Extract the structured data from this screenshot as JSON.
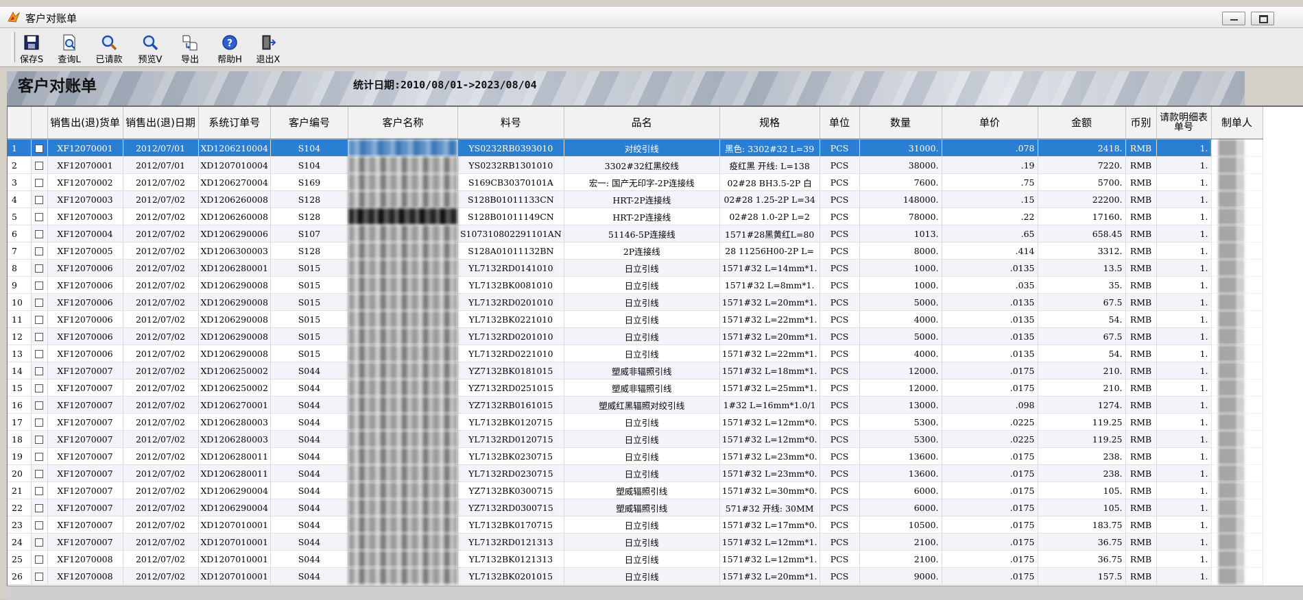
{
  "window": {
    "title": "客户对账单"
  },
  "toolbar": {
    "buttons": [
      {
        "id": "save",
        "label": "保存S",
        "icon": "save-icon"
      },
      {
        "id": "query",
        "label": "查询L",
        "icon": "document-search-icon"
      },
      {
        "id": "requested",
        "label": "已请款",
        "icon": "magnifier-icon"
      },
      {
        "id": "preview",
        "label": "预览V",
        "icon": "magnifier-icon"
      },
      {
        "id": "export",
        "label": "导出",
        "icon": "export-icon"
      },
      {
        "id": "help",
        "label": "帮助H",
        "icon": "help-icon"
      },
      {
        "id": "exit",
        "label": "退出X",
        "icon": "exit-door-icon"
      }
    ]
  },
  "report": {
    "title": "客户对账单",
    "date_range": "统计日期:2010/08/01->2023/08/04"
  },
  "grid": {
    "columns": [
      "",
      "",
      "销售出(退)货单",
      "销售出(退)日期",
      "系统订单号",
      "客户编号",
      "客户名称",
      "料号",
      "品名",
      "规格",
      "单位",
      "数量",
      "单价",
      "金额",
      "币别",
      "请款明细表单号",
      "制单人"
    ],
    "rows": [
      [
        "1",
        "XF12070001",
        "2012/07/01",
        "XD1206210004",
        "S104",
        "YS0232RB0393010",
        "对绞引线",
        "黑色: 3302#32 L=39",
        "PCS",
        "31000.",
        ".078",
        "2418.",
        "RMB",
        "1."
      ],
      [
        "2",
        "XF12070001",
        "2012/07/01",
        "XD1207010004",
        "S104",
        "YS0232RB1301010",
        "3302#32红黑绞线",
        "疫红黑 开线: L=138",
        "PCS",
        "38000.",
        ".19",
        "7220.",
        "RMB",
        "1."
      ],
      [
        "3",
        "XF12070002",
        "2012/07/02",
        "XD1206270004",
        "S169",
        "S169CB30370101A",
        "宏一: 国产无印字-2P连接线",
        "02#28 BH3.5-2P 白",
        "PCS",
        "7600.",
        ".75",
        "5700.",
        "RMB",
        "1."
      ],
      [
        "4",
        "XF12070003",
        "2012/07/02",
        "XD1206260008",
        "S128",
        "S128B01011133CN",
        "HRT-2P连接线",
        "02#28 1.25-2P L=34",
        "PCS",
        "148000.",
        ".15",
        "22200.",
        "RMB",
        "1."
      ],
      [
        "5",
        "XF12070003",
        "2012/07/02",
        "XD1206260008",
        "S128",
        "S128B01011149CN",
        "HRT-2P连接线",
        "02#28 1.0-2P L=2",
        "PCS",
        "78000.",
        ".22",
        "17160.",
        "RMB",
        "1."
      ],
      [
        "6",
        "XF12070004",
        "2012/07/02",
        "XD1206290006",
        "S107",
        "S107310802291101AN",
        "51146-5P连接线",
        "1571#28黑黄红L=80",
        "PCS",
        "1013.",
        ".65",
        "658.45",
        "RMB",
        "1."
      ],
      [
        "7",
        "XF12070005",
        "2012/07/02",
        "XD1206300003",
        "S128",
        "S128A01011132BN",
        "2P连接线",
        "28 11256H00-2P L=",
        "PCS",
        "8000.",
        ".414",
        "3312.",
        "RMB",
        "1."
      ],
      [
        "8",
        "XF12070006",
        "2012/07/02",
        "XD1206280001",
        "S015",
        "YL7132RD0141010",
        "日立引线",
        "1571#32 L=14mm*1.",
        "PCS",
        "1000.",
        ".0135",
        "13.5",
        "RMB",
        "1."
      ],
      [
        "9",
        "XF12070006",
        "2012/07/02",
        "XD1206290008",
        "S015",
        "YL7132BK0081010",
        "日立引线",
        "1571#32 L=8mm*1.",
        "PCS",
        "1000.",
        ".035",
        "35.",
        "RMB",
        "1."
      ],
      [
        "10",
        "XF12070006",
        "2012/07/02",
        "XD1206290008",
        "S015",
        "YL7132RD0201010",
        "日立引线",
        "1571#32 L=20mm*1.",
        "PCS",
        "5000.",
        ".0135",
        "67.5",
        "RMB",
        "1."
      ],
      [
        "11",
        "XF12070006",
        "2012/07/02",
        "XD1206290008",
        "S015",
        "YL7132BK0221010",
        "日立引线",
        "1571#32 L=22mm*1.",
        "PCS",
        "4000.",
        ".0135",
        "54.",
        "RMB",
        "1."
      ],
      [
        "12",
        "XF12070006",
        "2012/07/02",
        "XD1206290008",
        "S015",
        "YL7132RD0201010",
        "日立引线",
        "1571#32 L=20mm*1.",
        "PCS",
        "5000.",
        ".0135",
        "67.5",
        "RMB",
        "1."
      ],
      [
        "13",
        "XF12070006",
        "2012/07/02",
        "XD1206290008",
        "S015",
        "YL7132RD0221010",
        "日立引线",
        "1571#32 L=22mm*1.",
        "PCS",
        "4000.",
        ".0135",
        "54.",
        "RMB",
        "1."
      ],
      [
        "14",
        "XF12070007",
        "2012/07/02",
        "XD1206250002",
        "S044",
        "YZ7132BK0181015",
        "塑威非辐照引线",
        "1571#32 L=18mm*1.",
        "PCS",
        "12000.",
        ".0175",
        "210.",
        "RMB",
        "1."
      ],
      [
        "15",
        "XF12070007",
        "2012/07/02",
        "XD1206250002",
        "S044",
        "YZ7132RD0251015",
        "塑威非辐照引线",
        "1571#32 L=25mm*1.",
        "PCS",
        "12000.",
        ".0175",
        "210.",
        "RMB",
        "1."
      ],
      [
        "16",
        "XF12070007",
        "2012/07/02",
        "XD1206270001",
        "S044",
        "YZ7132RB0161015",
        "塑威红黑辐照对绞引线",
        "1#32 L=16mm*1.0/1",
        "PCS",
        "13000.",
        ".098",
        "1274.",
        "RMB",
        "1."
      ],
      [
        "17",
        "XF12070007",
        "2012/07/02",
        "XD1206280003",
        "S044",
        "YL7132BK0120715",
        "日立引线",
        "1571#32 L=12mm*0.",
        "PCS",
        "5300.",
        ".0225",
        "119.25",
        "RMB",
        "1."
      ],
      [
        "18",
        "XF12070007",
        "2012/07/02",
        "XD1206280003",
        "S044",
        "YL7132RD0120715",
        "日立引线",
        "1571#32 L=12mm*0.",
        "PCS",
        "5300.",
        ".0225",
        "119.25",
        "RMB",
        "1."
      ],
      [
        "19",
        "XF12070007",
        "2012/07/02",
        "XD1206280011",
        "S044",
        "YL7132BK0230715",
        "日立引线",
        "1571#32 L=23mm*0.",
        "PCS",
        "13600.",
        ".0175",
        "238.",
        "RMB",
        "1."
      ],
      [
        "20",
        "XF12070007",
        "2012/07/02",
        "XD1206280011",
        "S044",
        "YL7132RD0230715",
        "日立引线",
        "1571#32 L=23mm*0.",
        "PCS",
        "13600.",
        ".0175",
        "238.",
        "RMB",
        "1."
      ],
      [
        "21",
        "XF12070007",
        "2012/07/02",
        "XD1206290004",
        "S044",
        "YZ7132BK0300715",
        "塑威辐照引线",
        "1571#32 L=30mm*0.",
        "PCS",
        "6000.",
        ".0175",
        "105.",
        "RMB",
        "1."
      ],
      [
        "22",
        "XF12070007",
        "2012/07/02",
        "XD1206290004",
        "S044",
        "YZ7132RD0300715",
        "塑威辐照引线",
        "571#32 开线: 30MM",
        "PCS",
        "6000.",
        ".0175",
        "105.",
        "RMB",
        "1."
      ],
      [
        "23",
        "XF12070007",
        "2012/07/02",
        "XD1207010001",
        "S044",
        "YL7132BK0170715",
        "日立引线",
        "1571#32 L=17mm*0.",
        "PCS",
        "10500.",
        ".0175",
        "183.75",
        "RMB",
        "1."
      ],
      [
        "24",
        "XF12070007",
        "2012/07/02",
        "XD1207010001",
        "S044",
        "YL7132RD0121313",
        "日立引线",
        "1571#32 L=12mm*1.",
        "PCS",
        "2100.",
        ".0175",
        "36.75",
        "RMB",
        "1."
      ],
      [
        "25",
        "XF12070008",
        "2012/07/02",
        "XD1207010001",
        "S044",
        "YL7132BK0121313",
        "日立引线",
        "1571#32 L=12mm*1.",
        "PCS",
        "2100.",
        ".0175",
        "36.75",
        "RMB",
        "1."
      ],
      [
        "26",
        "XF12070008",
        "2012/07/02",
        "XD1207010001",
        "S044",
        "YL7132BK0201015",
        "日立引线",
        "1571#32 L=20mm*1.",
        "PCS",
        "9000.",
        ".0175",
        "157.5",
        "RMB",
        "1."
      ]
    ],
    "selected_row": 1
  },
  "colors": {
    "selection": "#2b7fd3",
    "alt_row": "#f2f4fa",
    "window_bg": "#d4d0c8"
  }
}
